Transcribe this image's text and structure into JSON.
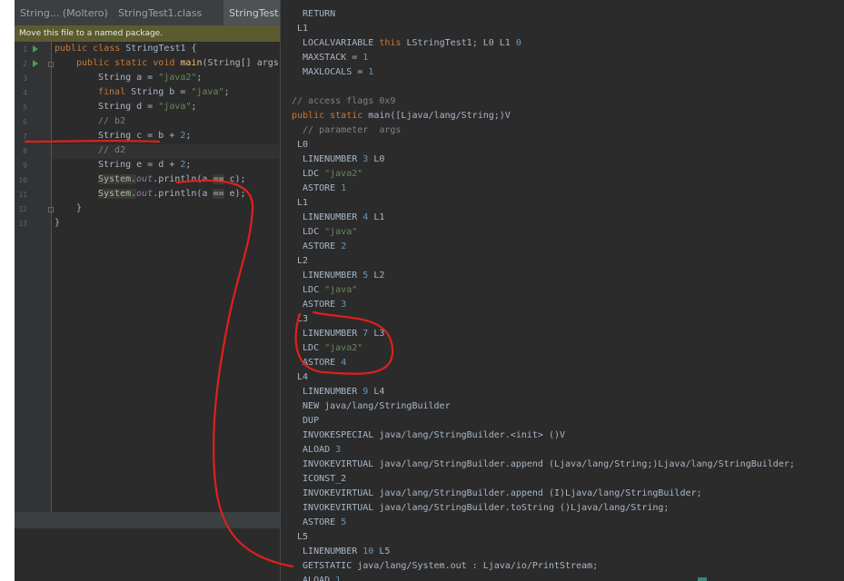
{
  "window": {
    "minimize_glyph": "—",
    "maximize_label": ""
  },
  "tabs": [
    {
      "label": "String... (Moltero)"
    },
    {
      "label": "StringTest1.class"
    },
    {
      "label": "StringTest..."
    }
  ],
  "notice": {
    "text": "Move this file to a named package."
  },
  "editor": {
    "line_numbers": [
      "1",
      "2",
      "3",
      "4",
      "5",
      "6",
      "7",
      "8",
      "9",
      "10",
      "11",
      "12",
      "13"
    ]
  },
  "code": [
    {
      "parts": [
        [
          "kw",
          "public class "
        ],
        [
          "plain",
          "StringTest1 {"
        ]
      ]
    },
    {
      "parts": [
        [
          "kw",
          "public static void "
        ],
        [
          "fn",
          "main"
        ],
        [
          "plain",
          "(String[] args)"
        ]
      ]
    },
    {
      "parts": [
        [
          "plain",
          "String a = "
        ],
        [
          "str",
          "\"java2\""
        ],
        [
          "plain",
          ";"
        ]
      ]
    },
    {
      "parts": [
        [
          "kw",
          "final "
        ],
        [
          "plain",
          "String b = "
        ],
        [
          "str",
          "\"java\""
        ],
        [
          "plain",
          ";"
        ]
      ]
    },
    {
      "parts": [
        [
          "plain",
          "String d = "
        ],
        [
          "str",
          "\"java\""
        ],
        [
          "plain",
          ";"
        ]
      ]
    },
    {
      "parts": [
        [
          "cmt",
          "// b2"
        ]
      ]
    },
    {
      "parts": [
        [
          "plain",
          "String c = b + "
        ],
        [
          "num",
          "2"
        ],
        [
          "plain",
          ";"
        ]
      ]
    },
    {
      "parts": [
        [
          "cmt",
          "// d2"
        ]
      ]
    },
    {
      "parts": [
        [
          "plain",
          "String e = d + "
        ],
        [
          "num",
          "2"
        ],
        [
          "plain",
          ";"
        ]
      ]
    },
    {
      "parts": [
        [
          "hl",
          "System."
        ],
        [
          "field",
          "out"
        ],
        [
          "plain",
          ".println(a "
        ],
        [
          "hl",
          "=="
        ],
        [
          "plain",
          " c);"
        ]
      ]
    },
    {
      "parts": [
        [
          "hl",
          "System."
        ],
        [
          "field",
          "out"
        ],
        [
          "plain",
          ".println(a "
        ],
        [
          "hl",
          "=="
        ],
        [
          "plain",
          " e);"
        ]
      ]
    },
    {
      "parts": [
        [
          "plain",
          "}"
        ]
      ]
    },
    {
      "parts": [
        [
          "plain",
          "}"
        ]
      ]
    }
  ],
  "bytecode": [
    {
      "parts": [
        [
          "plain",
          "  RETURN"
        ]
      ]
    },
    {
      "parts": [
        [
          "plain",
          " L1"
        ]
      ]
    },
    {
      "parts": [
        [
          "plain",
          "  LOCALVARIABLE "
        ],
        [
          "kw",
          "this"
        ],
        [
          "plain",
          " LStringTest1; L0 L1 "
        ],
        [
          "num",
          "0"
        ]
      ]
    },
    {
      "parts": [
        [
          "plain",
          "  MAXSTACK = "
        ],
        [
          "num",
          "1"
        ]
      ]
    },
    {
      "parts": [
        [
          "plain",
          "  MAXLOCALS = "
        ],
        [
          "num",
          "1"
        ]
      ]
    },
    {
      "parts": [
        [
          "plain",
          ""
        ]
      ]
    },
    {
      "parts": [
        [
          "cmt",
          "// access flags 0x9"
        ]
      ]
    },
    {
      "parts": [
        [
          "kw",
          "public static "
        ],
        [
          "plain",
          "main([Ljava/lang/String;)V"
        ]
      ]
    },
    {
      "parts": [
        [
          "cmt",
          "  // parameter  args"
        ]
      ]
    },
    {
      "parts": [
        [
          "plain",
          " L0"
        ]
      ]
    },
    {
      "parts": [
        [
          "plain",
          "  LINENUMBER "
        ],
        [
          "num",
          "3"
        ],
        [
          "plain",
          " L0"
        ]
      ]
    },
    {
      "parts": [
        [
          "plain",
          "  LDC "
        ],
        [
          "str",
          "\"java2\""
        ]
      ]
    },
    {
      "parts": [
        [
          "plain",
          "  ASTORE "
        ],
        [
          "num",
          "1"
        ]
      ]
    },
    {
      "parts": [
        [
          "plain",
          " L1"
        ]
      ]
    },
    {
      "parts": [
        [
          "plain",
          "  LINENUMBER "
        ],
        [
          "num",
          "4"
        ],
        [
          "plain",
          " L1"
        ]
      ]
    },
    {
      "parts": [
        [
          "plain",
          "  LDC "
        ],
        [
          "str",
          "\"java\""
        ]
      ]
    },
    {
      "parts": [
        [
          "plain",
          "  ASTORE "
        ],
        [
          "num",
          "2"
        ]
      ]
    },
    {
      "parts": [
        [
          "plain",
          " L2"
        ]
      ]
    },
    {
      "parts": [
        [
          "plain",
          "  LINENUMBER "
        ],
        [
          "num",
          "5"
        ],
        [
          "plain",
          " L2"
        ]
      ]
    },
    {
      "parts": [
        [
          "plain",
          "  LDC "
        ],
        [
          "str",
          "\"java\""
        ]
      ]
    },
    {
      "parts": [
        [
          "plain",
          "  ASTORE "
        ],
        [
          "num",
          "3"
        ]
      ]
    },
    {
      "parts": [
        [
          "plain",
          " L3"
        ]
      ]
    },
    {
      "parts": [
        [
          "plain",
          "  LINENUMBER "
        ],
        [
          "num",
          "7"
        ],
        [
          "plain",
          " L3"
        ]
      ]
    },
    {
      "parts": [
        [
          "plain",
          "  LDC "
        ],
        [
          "str",
          "\"java2\""
        ]
      ]
    },
    {
      "parts": [
        [
          "plain",
          "  ASTORE "
        ],
        [
          "num",
          "4"
        ]
      ]
    },
    {
      "parts": [
        [
          "plain",
          " L4"
        ]
      ]
    },
    {
      "parts": [
        [
          "plain",
          "  LINENUMBER "
        ],
        [
          "num",
          "9"
        ],
        [
          "plain",
          " L4"
        ]
      ]
    },
    {
      "parts": [
        [
          "plain",
          "  NEW java/lang/StringBuilder"
        ]
      ]
    },
    {
      "parts": [
        [
          "plain",
          "  DUP"
        ]
      ]
    },
    {
      "parts": [
        [
          "plain",
          "  INVOKESPECIAL java/lang/StringBuilder.<init> ()V"
        ]
      ]
    },
    {
      "parts": [
        [
          "plain",
          "  ALOAD "
        ],
        [
          "num",
          "3"
        ]
      ]
    },
    {
      "parts": [
        [
          "plain",
          "  INVOKEVIRTUAL java/lang/StringBuilder.append (Ljava/lang/String;)Ljava/lang/StringBuilder;"
        ]
      ]
    },
    {
      "parts": [
        [
          "plain",
          "  ICONST_2"
        ]
      ]
    },
    {
      "parts": [
        [
          "plain",
          "  INVOKEVIRTUAL java/lang/StringBuilder.append (I)Ljava/lang/StringBuilder;"
        ]
      ]
    },
    {
      "parts": [
        [
          "plain",
          "  INVOKEVIRTUAL java/lang/StringBuilder.toString ()Ljava/lang/String;"
        ]
      ]
    },
    {
      "parts": [
        [
          "plain",
          "  ASTORE "
        ],
        [
          "num",
          "5"
        ]
      ]
    },
    {
      "parts": [
        [
          "plain",
          " L5"
        ]
      ]
    },
    {
      "parts": [
        [
          "plain",
          "  LINENUMBER "
        ],
        [
          "num",
          "10"
        ],
        [
          "plain",
          " L5"
        ]
      ]
    },
    {
      "parts": [
        [
          "plain",
          "  GETSTATIC java/lang/System.out : Ljava/io/PrintStream;"
        ]
      ]
    },
    {
      "parts": [
        [
          "plain",
          "  ALOAD "
        ],
        [
          "num",
          "1"
        ]
      ]
    }
  ],
  "colors": {
    "editor_bg": "#2b2b2b",
    "keyword": "#cc7832",
    "string": "#6a8759",
    "number": "#6897bb",
    "comment": "#808080",
    "annotation_red": "#e0201a"
  }
}
